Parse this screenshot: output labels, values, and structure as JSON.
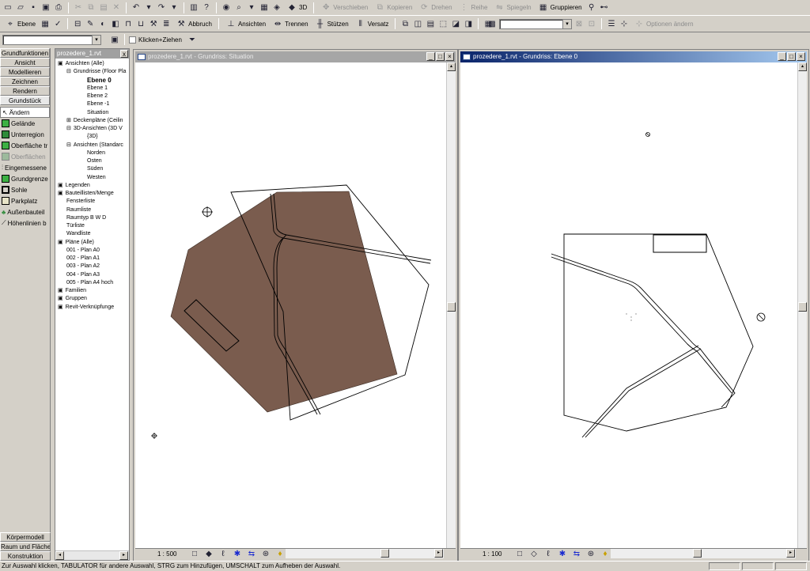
{
  "toolbar_edit": {
    "move": "Verschieben",
    "copy": "Kopieren",
    "rotate": "Drehen",
    "array": "Reihe",
    "mirror": "Spiegeln",
    "group": "Gruppieren",
    "view3d": "3D"
  },
  "toolbar_tools": {
    "level": "Ebene",
    "cancel": "Abbruch",
    "elevations": "Ansichten",
    "split": "Trennen",
    "supports": "Stützen",
    "offset": "Versatz",
    "options": "Optionen ändern"
  },
  "options_bar": {
    "drag_label": "Klicken+Ziehen"
  },
  "design_bar": {
    "tabs": [
      "Grundfunktionen",
      "Ansicht",
      "Modellieren",
      "Zeichnen",
      "Rendern",
      "Grundstück"
    ],
    "items": [
      "Ändern",
      "Gelände",
      "Unterregion",
      "Oberfläche tr",
      "Oberflächen",
      "Eingemessene",
      "Grundgrenze",
      "Sohle",
      "Parkplatz",
      "Außenbauteil",
      "Höhenlinien b"
    ],
    "bottom_tabs": [
      "Körpermodell",
      "Raum und Fläche",
      "Konstruktion"
    ]
  },
  "browser": {
    "title": "prozedere_1.rvt",
    "close": "x",
    "nodes": [
      "Ansichten (Alle)",
      "Grundrisse (Floor Pla",
      "Ebene 0",
      "Ebene 1",
      "Ebene 2",
      "Ebene -1",
      "Situation",
      "Deckenpläne (Ceilin",
      "3D-Ansichten (3D V",
      "{3D}",
      "Ansichten (Standarc",
      "Norden",
      "Osten",
      "Süden",
      "Westen",
      "Legenden",
      "Bauteillisten/Menge",
      "Fensterliste",
      "Raumliste",
      "Raumtyp B W D",
      "Türliste",
      "Wandliste",
      "Pläne (Alle)",
      "001 - Plan A0",
      "002 - Plan A1",
      "003 - Plan A2",
      "004 - Plan A3",
      "005 - Plan A4 hoch",
      "Familien",
      "Gruppen",
      "Revit-Verknüpfunge"
    ]
  },
  "views": [
    {
      "title": "prozedere_1.rvt - Grundriss: Situation",
      "scale": "1 : 500",
      "active": false
    },
    {
      "title": "prozedere_1.rvt - Grundriss: Ebene 0",
      "scale": "1 : 100",
      "active": true
    }
  ],
  "status_bar": {
    "text": "Zur Auswahl klicken, TABULATOR für andere Auswahl, STRG zum Hinzufügen, UMSCHALT zum Aufheben der Auswahl."
  },
  "colors": {
    "toposurface": "#7a5c4e",
    "active_title": "#0a246a",
    "chrome": "#d4d0c8"
  }
}
